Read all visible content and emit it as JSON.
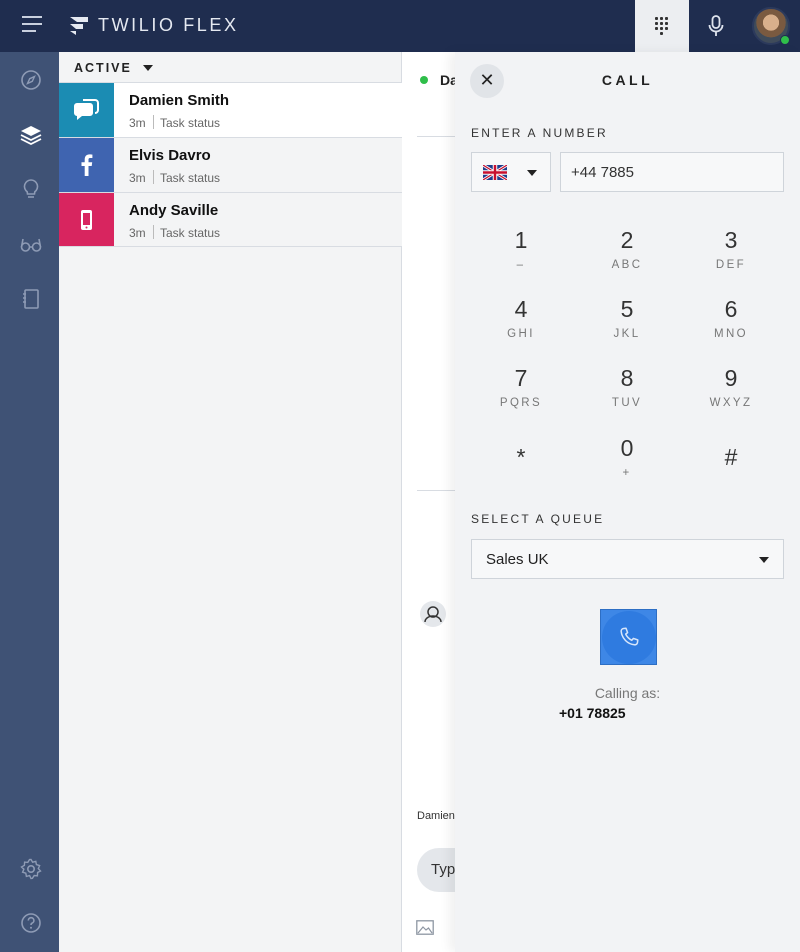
{
  "header": {
    "brand": "TWILIO FLEX"
  },
  "tasks": {
    "filter": "ACTIVE",
    "items": [
      {
        "name": "Damien Smith",
        "time": "3m",
        "status": "Task status",
        "channel": "chat",
        "color": "#1b8cb3"
      },
      {
        "name": "Elvis Davro",
        "time": "3m",
        "status": "Task status",
        "channel": "facebook",
        "color": "#3f64b0"
      },
      {
        "name": "Andy Saville",
        "time": "3m",
        "status": "Task status",
        "channel": "sms",
        "color": "#d8255f"
      }
    ]
  },
  "conversation": {
    "title": "Da",
    "author": "Damien",
    "input_placeholder": "Typ"
  },
  "dialer": {
    "title": "CALL",
    "enter_label": "ENTER A NUMBER",
    "country_flag": "uk-flag",
    "number_value": "+44 7885",
    "keys": [
      {
        "digit": "1",
        "letters": "–"
      },
      {
        "digit": "2",
        "letters": "ABC"
      },
      {
        "digit": "3",
        "letters": "DEF"
      },
      {
        "digit": "4",
        "letters": "GHI"
      },
      {
        "digit": "5",
        "letters": "JKL"
      },
      {
        "digit": "6",
        "letters": "MNO"
      },
      {
        "digit": "7",
        "letters": "PQRS"
      },
      {
        "digit": "8",
        "letters": "TUV"
      },
      {
        "digit": "9",
        "letters": "WXYZ"
      },
      {
        "digit": "*",
        "letters": ""
      },
      {
        "digit": "0",
        "letters": "+"
      },
      {
        "digit": "#",
        "letters": ""
      }
    ],
    "queue_label": "SELECT A QUEUE",
    "queue_value": "Sales UK",
    "calling_as_label": "Calling as:",
    "calling_as_number": "+01 78825"
  },
  "colors": {
    "topbar": "#1f2d4f",
    "sidebar": "#3f5275",
    "accent_call": "#2f7be0",
    "online": "#2fbe4a"
  }
}
